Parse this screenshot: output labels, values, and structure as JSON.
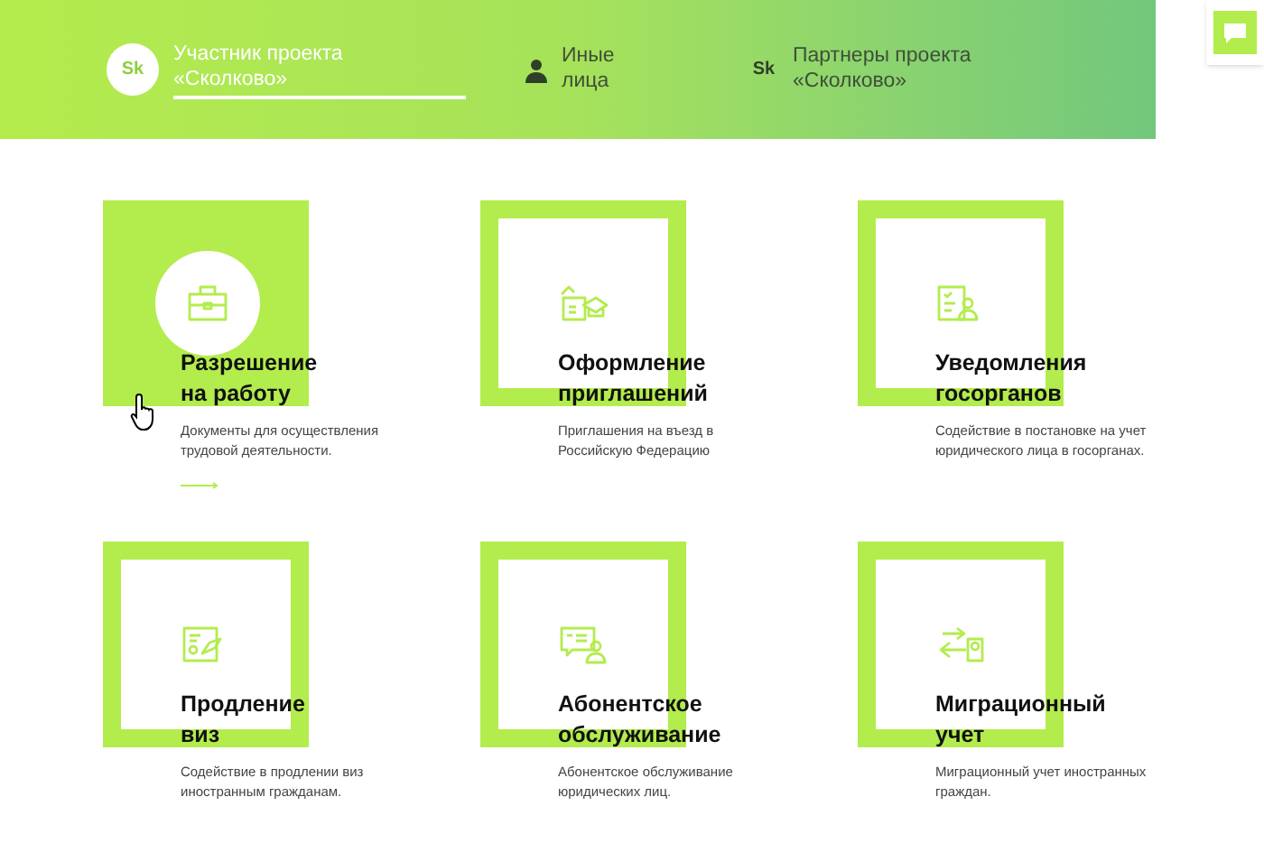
{
  "header": {
    "tabs": [
      {
        "kind": "logo",
        "icon_text": "Sk",
        "label": "Участник проекта «Сколково»",
        "selected": true
      },
      {
        "kind": "person",
        "label": "Иные лица",
        "selected": false
      },
      {
        "kind": "logo",
        "icon_text": "Sk",
        "label": "Партнеры проекта «Сколково»",
        "selected": false
      }
    ]
  },
  "services": [
    {
      "title": [
        "Разрешение",
        "на работу"
      ],
      "description": "Документы для осуществления трудовой деятельности.",
      "active": true
    },
    {
      "title": [
        "Оформление",
        "приглашений"
      ],
      "description": "Приглашения на въезд в Российскую Федерацию",
      "active": false
    },
    {
      "title": [
        "Уведомления",
        "госорганов"
      ],
      "description": "Содействие в постановке на учет юридического лица в госорганах.",
      "active": false
    },
    {
      "title": [
        "Продление",
        "виз"
      ],
      "description": "Содействие в продлении виз иностранным гражданам.",
      "active": false
    },
    {
      "title": [
        "Абонентское",
        "обслуживание"
      ],
      "description": "Абонентское обслуживание юридических лиц.",
      "active": false
    },
    {
      "title": [
        "Миграционный",
        "учет"
      ],
      "description": "Миграционный учет иностранных граждан.",
      "active": false
    }
  ]
}
